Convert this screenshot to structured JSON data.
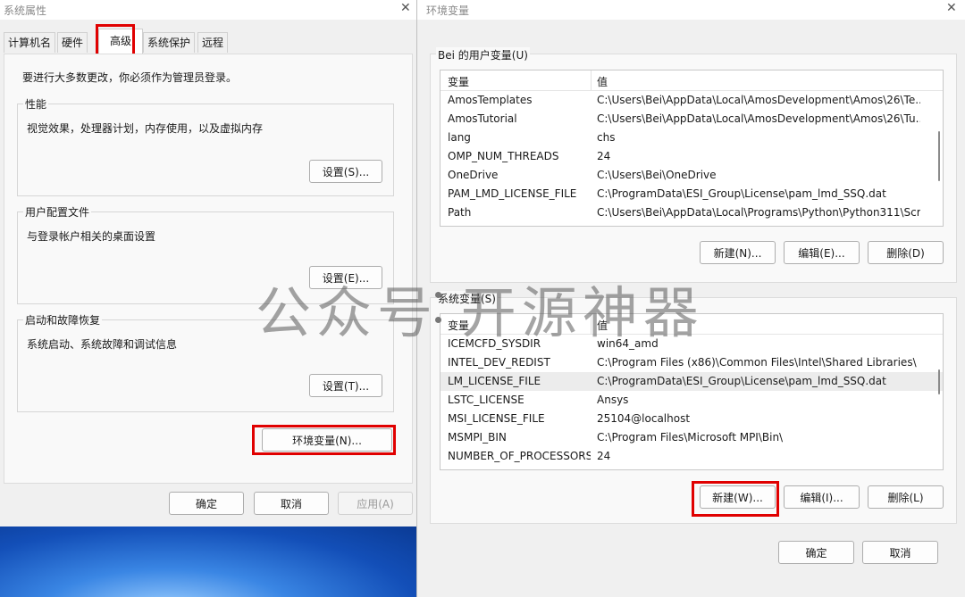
{
  "system_properties": {
    "title": "系统属性",
    "close_glyph": "✕",
    "tabs": [
      "计算机名",
      "硬件",
      "高级",
      "系统保护",
      "远程"
    ],
    "active_tab": "高级",
    "note": "要进行大多数更改，你必须作为管理员登录。",
    "performance": {
      "label": "性能",
      "desc": "视觉效果，处理器计划，内存使用，以及虚拟内存",
      "button": "设置(S)..."
    },
    "profile": {
      "label": "用户配置文件",
      "desc": "与登录帐户相关的桌面设置",
      "button": "设置(E)..."
    },
    "startup": {
      "label": "启动和故障恢复",
      "desc": "系统启动、系统故障和调试信息",
      "button": "设置(T)..."
    },
    "env_button": "环境变量(N)...",
    "ok": "确定",
    "cancel": "取消",
    "apply": "应用(A)"
  },
  "environment_variables": {
    "title": "环境变量",
    "close_glyph": "✕",
    "user_section": {
      "label": "Bei 的用户变量(U)",
      "col_var": "变量",
      "col_val": "值",
      "rows": [
        [
          "AmosTemplates",
          "C:\\Users\\Bei\\AppData\\Local\\AmosDevelopment\\Amos\\26\\Te..."
        ],
        [
          "AmosTutorial",
          "C:\\Users\\Bei\\AppData\\Local\\AmosDevelopment\\Amos\\26\\Tu..."
        ],
        [
          "lang",
          "chs"
        ],
        [
          "OMP_NUM_THREADS",
          "24"
        ],
        [
          "OneDrive",
          "C:\\Users\\Bei\\OneDrive"
        ],
        [
          "PAM_LMD_LICENSE_FILE",
          "C:\\ProgramData\\ESI_Group\\License\\pam_lmd_SSQ.dat"
        ],
        [
          "Path",
          "C:\\Users\\Bei\\AppData\\Local\\Programs\\Python\\Python311\\Scr..."
        ]
      ],
      "new": "新建(N)...",
      "edit": "编辑(E)...",
      "delete": "删除(D)"
    },
    "system_section": {
      "label": "系统变量(S)",
      "col_var": "变量",
      "col_val": "值",
      "rows": [
        [
          "ICEMCFD_SYSDIR",
          "win64_amd"
        ],
        [
          "INTEL_DEV_REDIST",
          "C:\\Program Files (x86)\\Common Files\\Intel\\Shared Libraries\\"
        ],
        [
          "LM_LICENSE_FILE",
          "C:\\ProgramData\\ESI_Group\\License\\pam_lmd_SSQ.dat"
        ],
        [
          "LSTC_LICENSE",
          "Ansys"
        ],
        [
          "MSI_LICENSE_FILE",
          "25104@localhost"
        ],
        [
          "MSMPI_BIN",
          "C:\\Program Files\\Microsoft MPI\\Bin\\"
        ],
        [
          "NUMBER_OF_PROCESSORS",
          "24"
        ]
      ],
      "selected_row": 2,
      "new": "新建(W)...",
      "edit": "编辑(I)...",
      "delete": "删除(L)"
    },
    "ok": "确定",
    "cancel": "取消"
  },
  "watermark": "公众号 开源神器",
  "colors": {
    "highlight_box": "#e00000",
    "dialog_bg": "#f0f0f0"
  }
}
